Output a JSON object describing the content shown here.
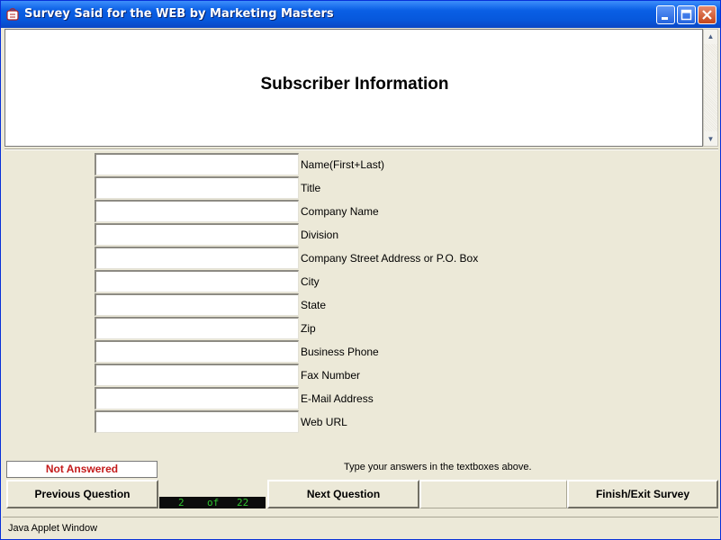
{
  "window": {
    "title": "Survey Said for the WEB by Marketing Masters",
    "app_icon": "survey-app-icon",
    "controls": [
      "minimize-icon",
      "maximize-icon",
      "close-icon"
    ]
  },
  "header": {
    "title": "Subscriber Information"
  },
  "form": {
    "fields": [
      {
        "label": "Name(First+Last)",
        "value": ""
      },
      {
        "label": "Title",
        "value": ""
      },
      {
        "label": "Company Name",
        "value": ""
      },
      {
        "label": "Division",
        "value": ""
      },
      {
        "label": "Company Street Address or P.O. Box",
        "value": ""
      },
      {
        "label": "City",
        "value": ""
      },
      {
        "label": "State",
        "value": ""
      },
      {
        "label": "Zip",
        "value": ""
      },
      {
        "label": "Business Phone",
        "value": ""
      },
      {
        "label": "Fax Number",
        "value": ""
      },
      {
        "label": "E-Mail Address",
        "value": ""
      },
      {
        "label": "Web URL",
        "value": ""
      }
    ]
  },
  "status": {
    "answer_state": "Not Answered",
    "answer_state_color": "#c41b1b",
    "instruction": "Type your answers in the textboxes above."
  },
  "navigation": {
    "previous_label": "Previous Question",
    "next_label": "Next Question",
    "finish_label": "Finish/Exit Survey",
    "current": "2",
    "of_label": "of",
    "total": "22",
    "counter_color": "#2fc42f"
  },
  "footer": {
    "applet_label": "Java Applet Window"
  }
}
